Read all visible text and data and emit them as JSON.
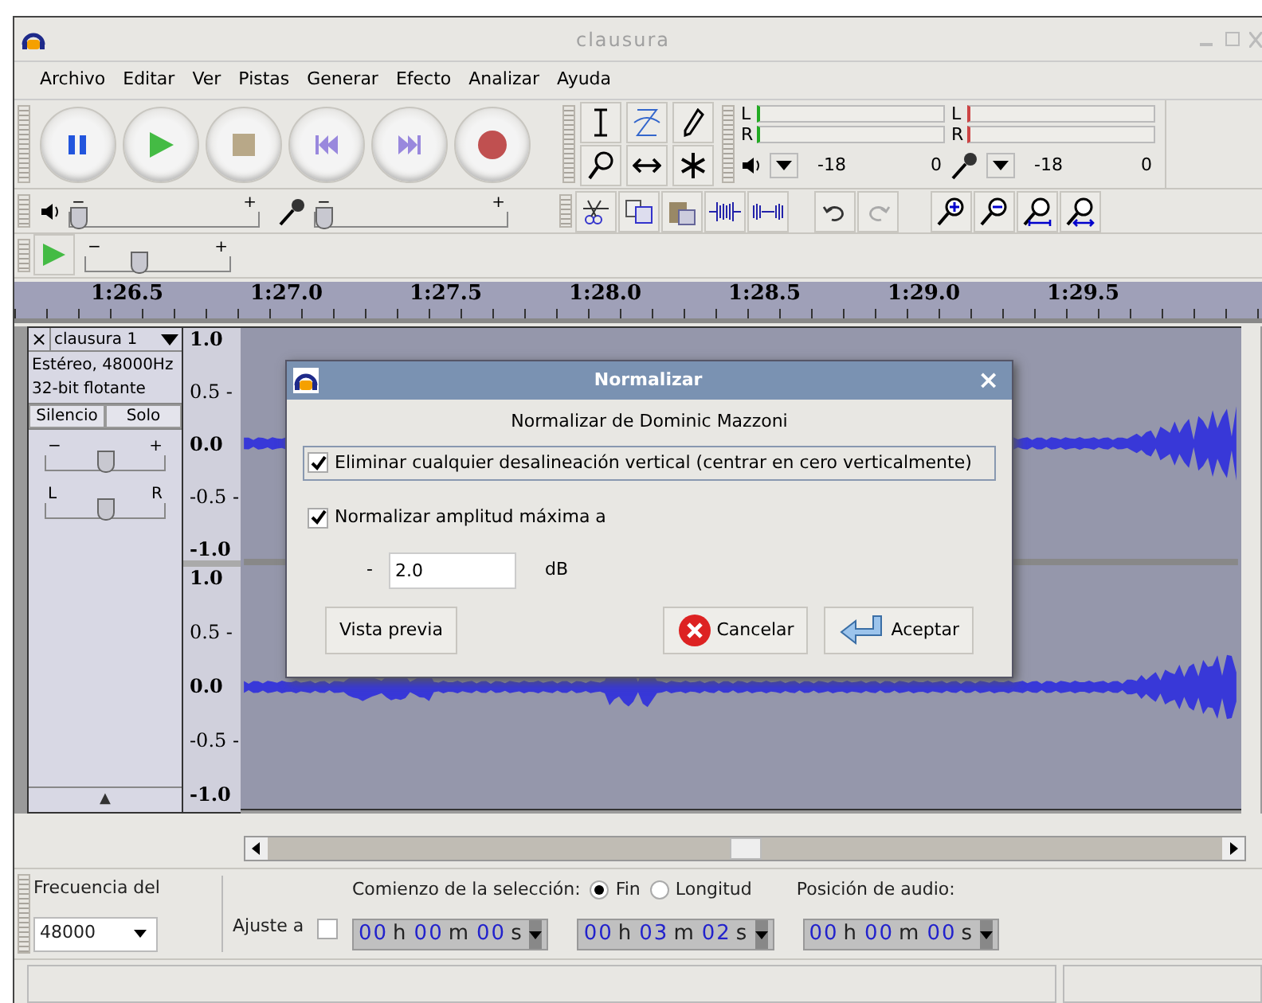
{
  "window": {
    "title": "clausura"
  },
  "menu": [
    "Archivo",
    "Editar",
    "Ver",
    "Pistas",
    "Generar",
    "Efecto",
    "Analizar",
    "Ayuda"
  ],
  "meters": [
    {
      "kind": "playback",
      "left": "L",
      "right": "R",
      "ticks": [
        "-18",
        "0"
      ]
    },
    {
      "kind": "record",
      "left": "L",
      "right": "R",
      "ticks": [
        "-18",
        "0"
      ]
    }
  ],
  "mixer": {
    "playback_volume": {
      "minus": "−",
      "plus": "+",
      "level": 0.0
    },
    "record_volume": {
      "minus": "−",
      "plus": "+",
      "level": 0.0
    }
  },
  "play_at_speed": {
    "minus": "−",
    "plus": "+",
    "level": 0.35
  },
  "timeline": [
    "1:26.5",
    "1:27.0",
    "1:27.5",
    "1:28.0",
    "1:28.5",
    "1:29.0",
    "1:29.5"
  ],
  "track": {
    "name": "clausura 1",
    "close": "×",
    "info": [
      "Estéreo, 48000Hz",
      "32-bit flotante"
    ],
    "mute": "Silencio",
    "solo": "Solo",
    "gain": {
      "minus": "−",
      "plus": "+",
      "level": 0.5
    },
    "pan": {
      "left": "L",
      "right": "R",
      "level": 0.5
    },
    "collapse": "▲",
    "channels": [
      {
        "scale": [
          "1.0",
          "0.5 -",
          "0.0",
          "-0.5 -",
          "-1.0"
        ]
      },
      {
        "scale": [
          "1.0",
          "0.5 -",
          "0.0",
          "-0.5 -",
          "-1.0"
        ]
      }
    ]
  },
  "dialog": {
    "title": "Normalizar",
    "close": "×",
    "subtitle": "Normalizar de Dominic Mazzoni",
    "options": [
      {
        "label": "Eliminar cualquier desalineación vertical (centrar en cero verticalmente)",
        "checked": true,
        "focused": true
      },
      {
        "label": "Normalizar amplitud máxima a",
        "checked": true,
        "focused": false
      }
    ],
    "amount": {
      "prefix": "-",
      "value": "2.0",
      "unit": "dB"
    },
    "buttons": [
      {
        "kind": "preview",
        "label": "Vista previa"
      },
      {
        "kind": "cancel",
        "label": "Cancelar"
      },
      {
        "kind": "ok",
        "label": "Aceptar"
      }
    ]
  },
  "selection_bar": {
    "rate_label": "Frecuencia del",
    "rate": "48000",
    "snap_label": "Ajuste a",
    "snap": false,
    "start_label": "Comienzo de la selección:",
    "modes": [
      {
        "label": "Fin",
        "selected": true
      },
      {
        "label": "Longitud",
        "selected": false
      }
    ],
    "position_label": "Posición de audio:",
    "times": [
      [
        "00",
        "h",
        "00",
        "m",
        "00",
        "s"
      ],
      [
        "00",
        "h",
        "03",
        "m",
        "02",
        "s"
      ],
      [
        "00",
        "h",
        "00",
        "m",
        "00",
        "s"
      ]
    ]
  }
}
